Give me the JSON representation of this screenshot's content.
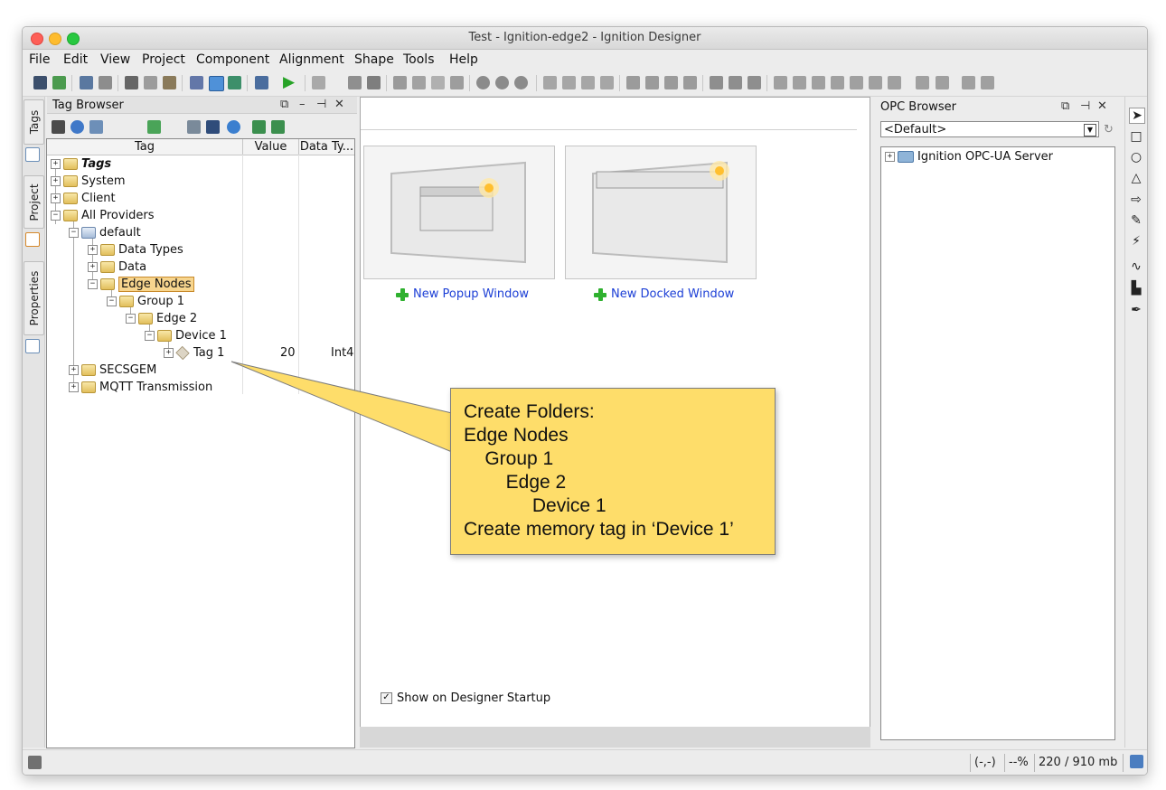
{
  "window": {
    "title": "Test - Ignition-edge2 - Ignition Designer"
  },
  "menu": [
    "File",
    "Edit",
    "View",
    "Project",
    "Component",
    "Alignment",
    "Shape",
    "Tools",
    "Help"
  ],
  "left_tabs": [
    "Tags",
    "Project",
    "Properties"
  ],
  "tag_browser": {
    "title": "Tag Browser",
    "columns": [
      "Tag",
      "Value",
      "Data Ty..."
    ],
    "rows": [
      {
        "label": "Tags",
        "value": "",
        "type": ""
      },
      {
        "label": "System",
        "value": "",
        "type": ""
      },
      {
        "label": "Client",
        "value": "",
        "type": ""
      },
      {
        "label": "All Providers",
        "value": "",
        "type": ""
      },
      {
        "label": "default",
        "value": "",
        "type": ""
      },
      {
        "label": "Data Types",
        "value": "",
        "type": ""
      },
      {
        "label": "Data",
        "value": "",
        "type": ""
      },
      {
        "label": "Edge Nodes",
        "value": "",
        "type": ""
      },
      {
        "label": "Group 1",
        "value": "",
        "type": ""
      },
      {
        "label": "Edge 2",
        "value": "",
        "type": ""
      },
      {
        "label": "Device 1",
        "value": "",
        "type": ""
      },
      {
        "label": "Tag 1",
        "value": "20",
        "type": "Int4"
      },
      {
        "label": "SECSGEM",
        "value": "",
        "type": ""
      },
      {
        "label": "MQTT Transmission",
        "value": "",
        "type": ""
      }
    ]
  },
  "workspace": {
    "new_popup_label": "New Popup Window",
    "new_docked_label": "New Docked Window",
    "show_on_startup_label": "Show on Designer Startup",
    "show_on_startup_checked": true
  },
  "opc_browser": {
    "title": "OPC Browser",
    "dropdown_value": "<Default>",
    "tree_items": [
      "Ignition OPC-UA Server"
    ]
  },
  "status": {
    "coords": "(-,-)",
    "zoom": "--%",
    "memory": "220 / 910 mb"
  },
  "callout": {
    "lines": [
      "Create Folders:",
      "Edge Nodes",
      "    Group 1",
      "        Edge 2",
      "             Device 1",
      "Create memory tag in ‘Device 1’"
    ],
    "color": "#fedd6a"
  }
}
